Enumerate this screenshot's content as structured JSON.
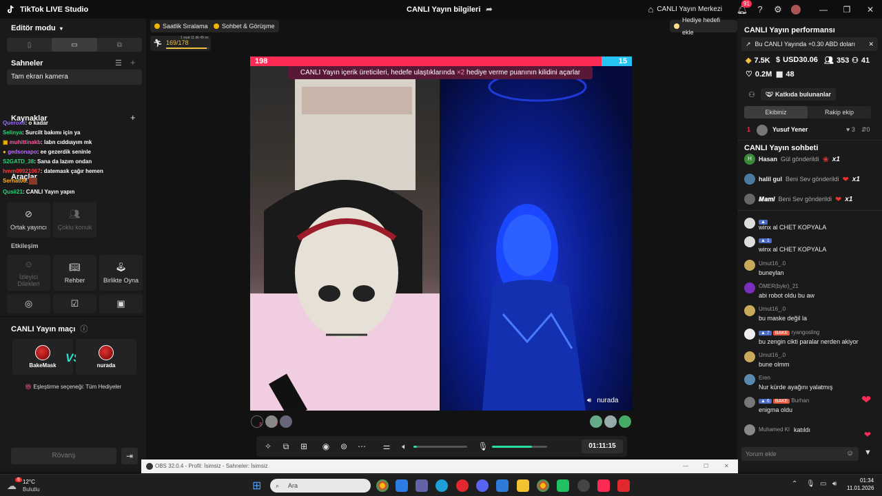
{
  "titlebar": {
    "app_title": "TikTok LIVE Studio",
    "center_title": "CANLI Yayın bilgileri",
    "live_center": "CANLI Yayın Merkezi",
    "notification_count": "91"
  },
  "left": {
    "editor_mode": "Editör modu",
    "scenes_title": "Sahneler",
    "scene_item": "Tam ekran kamera",
    "sources_title": "Kaynaklar",
    "tools_title": "Araçlar",
    "interaction_title": "Etkileşim",
    "overlay_chat": [
      {
        "name": "Querox6",
        "text": ": o kadar",
        "color": "#9a6bff"
      },
      {
        "name": "Selinya",
        "text": ": Surcilt bakımı için ya",
        "color": "#2ad67a"
      },
      {
        "name": "muhittinakb",
        "text": ": labn cıddıayım mk",
        "color": "#ff5aa0"
      },
      {
        "name": "gedsonapo",
        "text": ": ee gezerdik seninle",
        "color": "#b96bff"
      },
      {
        "name": "S2GATD_38",
        "text": ": Sana da lazım ondan",
        "color": "#2ad67a"
      },
      {
        "name": "hmm09921067",
        "text": ": datemask çağır hemen",
        "color": "#ff3b3b"
      },
      {
        "name": "Serhat06",
        "text": ":",
        "color": "#ffb02e"
      },
      {
        "name": "Qusii21",
        "text": ": CANLI Yayın yapın",
        "color": "#2ad67a"
      }
    ],
    "tool_cards": [
      {
        "label": "Ortak yayıncı",
        "icon": "link-icon"
      },
      {
        "label": "Çoklu konuk",
        "icon": "users-icon"
      }
    ],
    "interaction_cards": [
      {
        "label": "İzleyici Dilekleri",
        "icon": "viewer-icon"
      },
      {
        "label": "Rehber",
        "icon": "book-icon"
      },
      {
        "label": "Birlikte Oyna",
        "icon": "joystick-icon"
      }
    ],
    "match_title": "CANLI Yayın maçı",
    "opponent_left": "BakeMask",
    "opponent_right": "nurada",
    "vs": "VS",
    "matching_option": "Eşleştirme seçeneği: Tüm Hediyeler",
    "rematch": "Rövanş"
  },
  "center": {
    "hourly_ranking": "Saatlik Sıralama",
    "chat_and_meet": "Sohbet & Görüşme",
    "gift_goal": "Hediye hedefi ekle",
    "progress_text": "169/178",
    "progress_sub": "1 saat 11 dk 49 sn",
    "score_left": "198",
    "score_right": "15",
    "battle_banner_prefix": "CANLI Yayın içerik üreticileri, hedefe ulaştıklarında ",
    "battle_banner_mult": "×2",
    "battle_banner_suffix": " hediye verme puanının kilidini açarlar",
    "right_cam_name": "nurada",
    "left_supporter_count": "3",
    "left_supporter_count2": "2",
    "right_supporter_count": "2",
    "timer": "01:11:15"
  },
  "right": {
    "perf_title": "CANLI Yayın performansı",
    "promo": "Bu CANLI Yayında +0.30 ABD doları",
    "stats": {
      "coins": "7.5K",
      "usd": "USD30.06",
      "viewers": "353",
      "new": "41",
      "likes": "0.2M",
      "gifters": "48"
    },
    "contributors": "Katkıda bulunanlar",
    "tab_team": "Ekibiniz",
    "tab_rival": "Rakip ekip",
    "top_rank": "1",
    "top_name": "Yusuf Yener",
    "top_hearts": "3",
    "top_score": "0",
    "chat_title": "CANLI Yayın sohbeti",
    "gifts": [
      {
        "name": "Hasan",
        "action": "Gül gönderildi",
        "mult": "x1"
      },
      {
        "name": "halil gul",
        "action": "Beni Sev gönderildi",
        "mult": "x1"
      },
      {
        "name": "𝑴𝒂𝒎𝒊",
        "action": "Beni Sev gönderildi",
        "mult": "x1"
      }
    ],
    "messages": [
      {
        "level": "",
        "fan": "",
        "name": "",
        "text": "winx al CHET KOPYALA"
      },
      {
        "level": "1",
        "fan": "",
        "name": "",
        "text": "winx al CHET KOPYALA"
      },
      {
        "level": "",
        "fan": "",
        "name": "Umut16_.0",
        "text": "buneylan"
      },
      {
        "level": "",
        "fan": "",
        "name": "ÖMER(bykr)_21",
        "text": "abi robot oldu bu aw"
      },
      {
        "level": "",
        "fan": "",
        "name": "Umut16_.0",
        "text": "bu maske değil la"
      },
      {
        "level": "7",
        "fan": "BAKE",
        "name": "ryangosling",
        "text": "bu zengin cikti paralar nerden akiyor"
      },
      {
        "level": "",
        "fan": "",
        "name": "Umut16_.0",
        "text": "bune olmm"
      },
      {
        "level": "",
        "fan": "",
        "name": "Eren",
        "text": "Nur kürde ayağını yalatmış"
      },
      {
        "level": "6",
        "fan": "BAKE",
        "name": "Burhan",
        "text": "enigma oldu"
      }
    ],
    "joined_name": "Muhamed Kl",
    "joined_text": "katıldı",
    "comment_placeholder": "Yorum ekle"
  },
  "obs": {
    "title": "OBS 32.0.4 - Profil: İsimsiz - Sahneler: İsimsiz"
  },
  "taskbar": {
    "weather_temp": "12°C",
    "weather_desc": "Bulutlu",
    "weather_badge": "6",
    "search_placeholder": "Ara",
    "time": "01:34",
    "date": "11.01.2026"
  },
  "colors": {
    "accent_red": "#fe2c55",
    "accent_blue": "#25c4f5",
    "accent_green": "#27e0a2"
  }
}
